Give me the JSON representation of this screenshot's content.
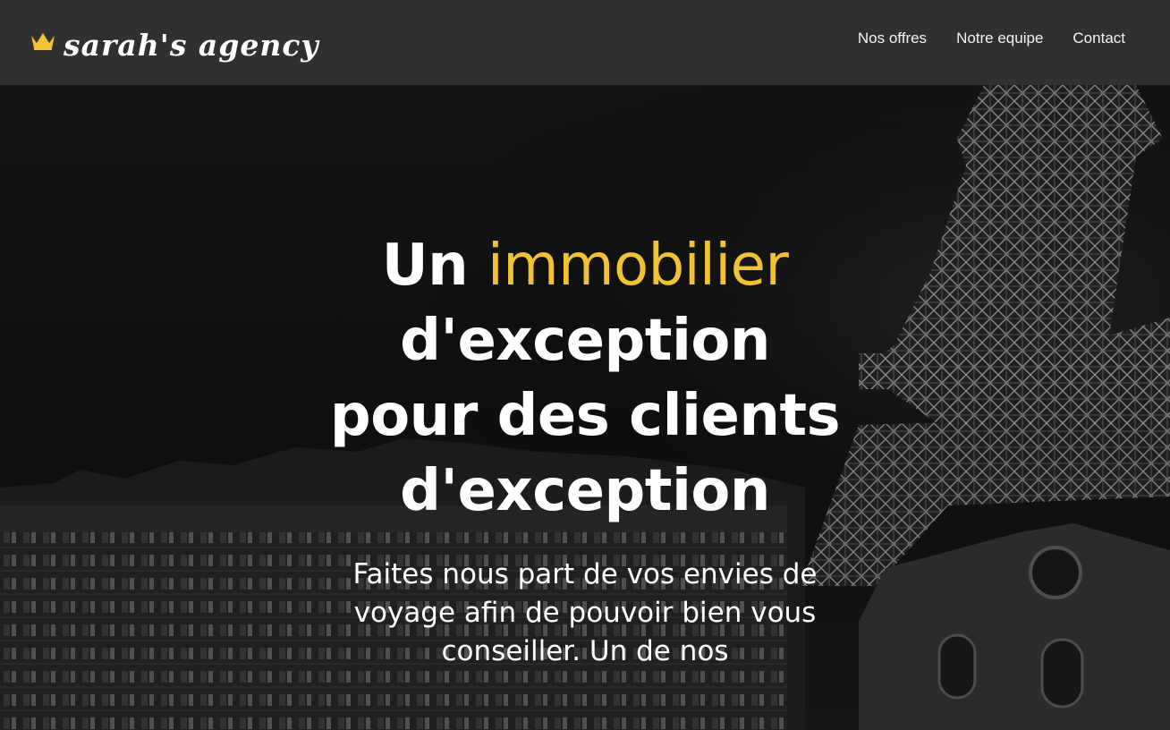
{
  "header": {
    "brand_name": "sarah's agency",
    "brand_icon": "crown-icon",
    "nav": [
      {
        "label": "Nos offres"
      },
      {
        "label": "Notre equipe"
      },
      {
        "label": "Contact"
      }
    ]
  },
  "hero": {
    "title_word_1": "Un",
    "title_accent": "immobilier",
    "title_rest": "d'exception pour des clients d'exception",
    "subtitle": "Faites nous part de vos envies de voyage afin de pouvoir bien vous conseiller. Un de nos",
    "background": "eiffel-tower-night-photo"
  },
  "colors": {
    "nav_background": "#303030",
    "accent": "#f1c232",
    "text": "#ffffff"
  }
}
